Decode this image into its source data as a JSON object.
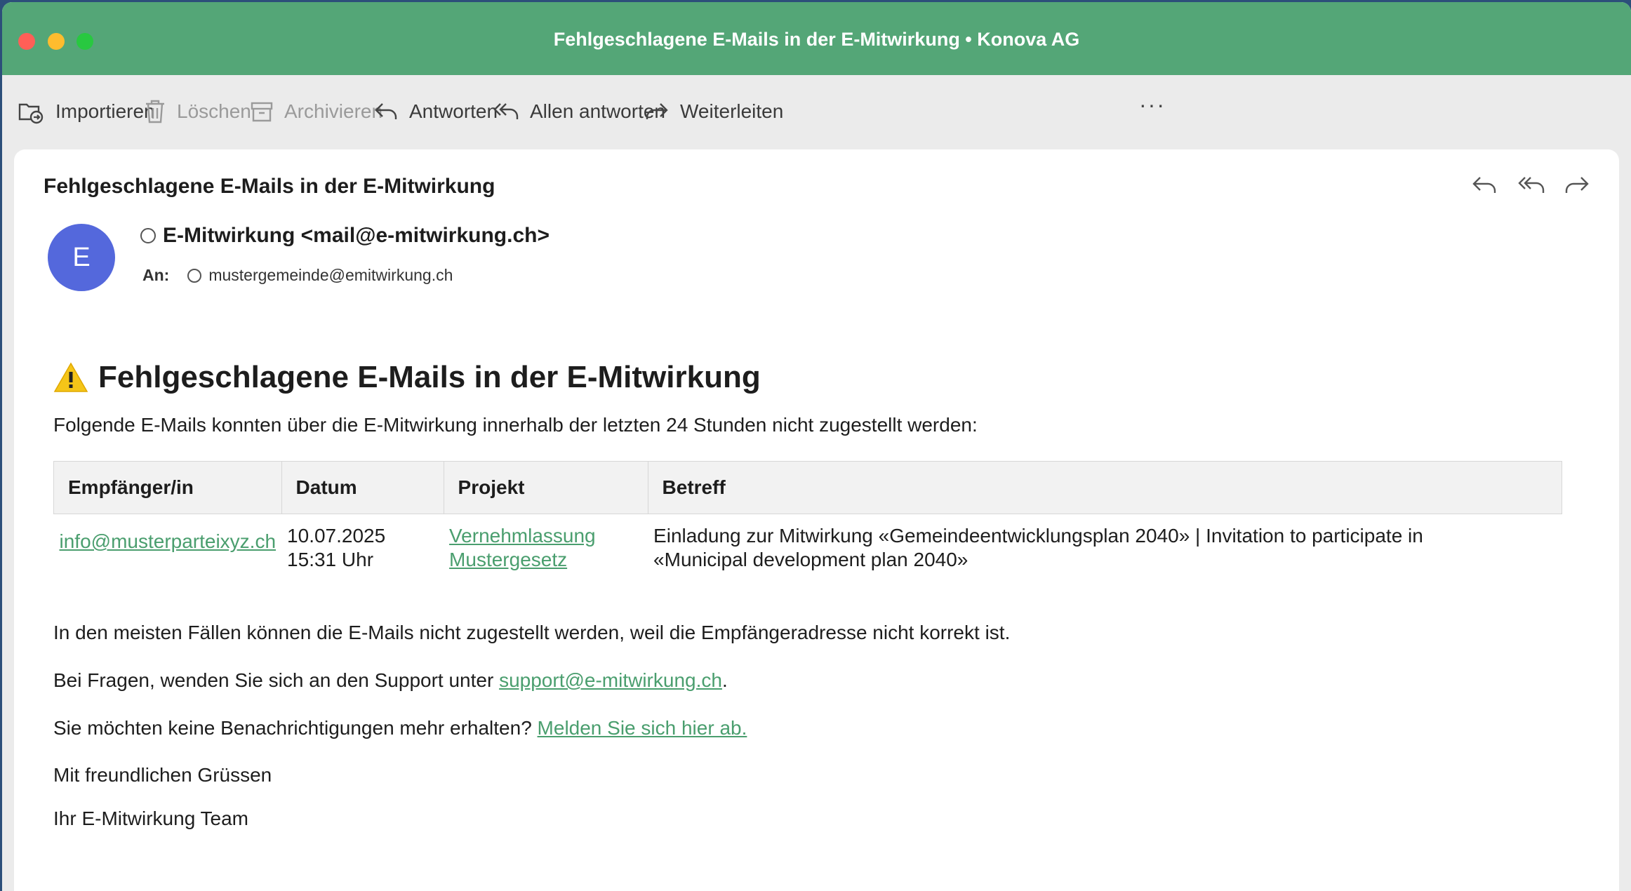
{
  "window": {
    "title": "Fehlgeschlagene E-Mails in der E-Mitwirkung • Konova AG"
  },
  "toolbar": {
    "import_label": "Importieren",
    "delete_label": "Löschen",
    "archive_label": "Archivieren",
    "reply_label": "Antworten",
    "reply_all_label": "Allen antworten",
    "forward_label": "Weiterleiten",
    "more_label": "···"
  },
  "message": {
    "subject": "Fehlgeschlagene E-Mails in der E-Mitwirkung",
    "avatar_initial": "E",
    "sender": "E-Mitwirkung <mail@e-mitwirkung.ch>",
    "to_label": "An:",
    "recipient": "mustergemeinde@emitwirkung.ch"
  },
  "content": {
    "heading": "Fehlgeschlagene E-Mails in der E-Mitwirkung",
    "intro": "Folgende E-Mails konnten über die E-Mitwirkung innerhalb der letzten 24 Stunden nicht zugestellt werden:",
    "table": {
      "headers": [
        "Empfänger/in",
        "Datum",
        "Projekt",
        "Betreff"
      ],
      "rows": [
        {
          "recipient": "info@musterparteixyz.ch",
          "date": "10.07.2025",
          "time": "15:31 Uhr",
          "project_line1": "Vernehmlassung",
          "project_line2": "Mustergesetz",
          "subject_line1": "Einladung zur Mitwirkung «Gemeindeentwicklungsplan 2040» | Invitation to participate in",
          "subject_line2": "«Municipal development plan 2040»"
        }
      ]
    },
    "note": "In den meisten Fällen können die E-Mails nicht zugestellt werden, weil die Empfängeradresse nicht korrekt ist.",
    "support_prefix": "Bei Fragen, wenden Sie sich an den Support unter ",
    "support_email": "support@e-mitwirkung.ch",
    "support_suffix": ".",
    "unsubscribe_prefix": "Sie möchten keine Benachrichtigungen mehr erhalten? ",
    "unsubscribe_link": "Melden Sie sich hier ab.",
    "greeting": "Mit freundlichen Grüssen",
    "signature": "Ihr E-Mitwirkung Team"
  },
  "colors": {
    "titlebar": "#54a677",
    "link": "#4a9e6e",
    "avatar": "#5468dc",
    "warning": "#f5c518"
  },
  "icons": [
    "import-icon",
    "trash-icon",
    "archive-icon",
    "reply-icon",
    "reply-all-icon",
    "forward-icon",
    "warning-icon"
  ]
}
